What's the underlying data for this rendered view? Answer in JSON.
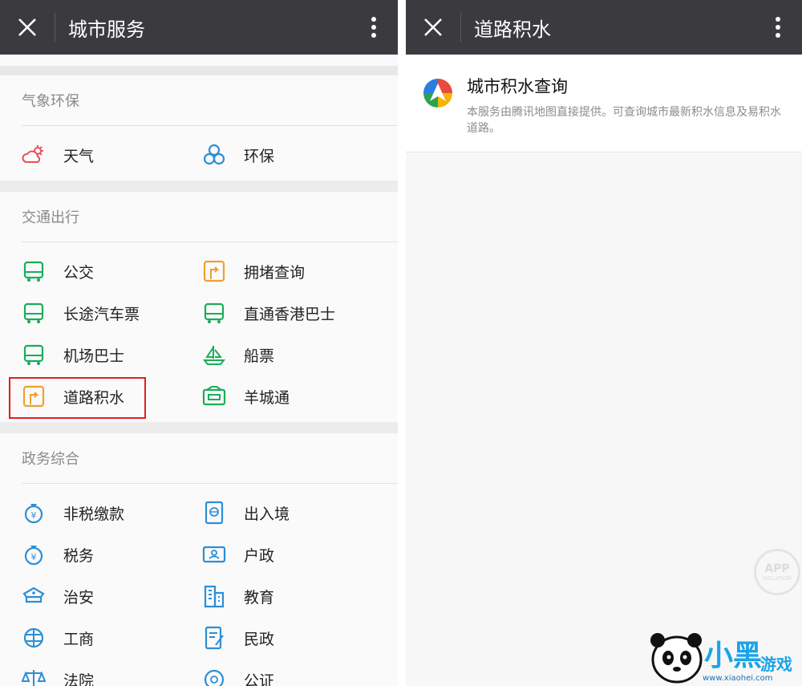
{
  "left": {
    "title": "城市服务",
    "sections": [
      {
        "header": "气象环保",
        "items": [
          {
            "label": "天气",
            "icon": "weather-icon"
          },
          {
            "label": "环保",
            "icon": "recycle-icon"
          }
        ]
      },
      {
        "header": "交通出行",
        "items": [
          {
            "label": "公交",
            "icon": "bus-icon"
          },
          {
            "label": "拥堵查询",
            "icon": "road-sign-icon"
          },
          {
            "label": "长途汽车票",
            "icon": "bus-icon"
          },
          {
            "label": "直通香港巴士",
            "icon": "bus-icon"
          },
          {
            "label": "机场巴士",
            "icon": "bus-icon"
          },
          {
            "label": "船票",
            "icon": "ship-icon"
          },
          {
            "label": "道路积水",
            "icon": "road-sign-icon"
          },
          {
            "label": "羊城通",
            "icon": "card-icon"
          }
        ]
      },
      {
        "header": "政务综合",
        "items": [
          {
            "label": "非税缴款",
            "icon": "money-bag-icon"
          },
          {
            "label": "出入境",
            "icon": "passport-icon"
          },
          {
            "label": "税务",
            "icon": "money-bag-icon"
          },
          {
            "label": "户政",
            "icon": "id-card-icon"
          },
          {
            "label": "治安",
            "icon": "police-cap-icon"
          },
          {
            "label": "教育",
            "icon": "building-icon"
          },
          {
            "label": "工商",
            "icon": "globe-icon"
          },
          {
            "label": "民政",
            "icon": "document-icon"
          },
          {
            "label": "法院",
            "icon": "scales-icon"
          },
          {
            "label": "公证",
            "icon": "seal-icon"
          }
        ]
      }
    ]
  },
  "right": {
    "title": "道路积水",
    "service": {
      "name": "城市积水查询",
      "description": "本服务由腾讯地图直接提供。可查询城市最新积水信息及易积水道路。"
    }
  },
  "watermark": {
    "app_text": "APP",
    "app_sub": "SOLUTION"
  },
  "site_logo": {
    "brand": "小黑",
    "brand2": "游戏",
    "url": "www.xiaohei.com"
  },
  "colors": {
    "topbar": "#3b3b3f",
    "green_icon": "#1aad5a",
    "blue_icon": "#2b8fd6",
    "orange_icon": "#f0a030",
    "highlight": "#e02020"
  }
}
